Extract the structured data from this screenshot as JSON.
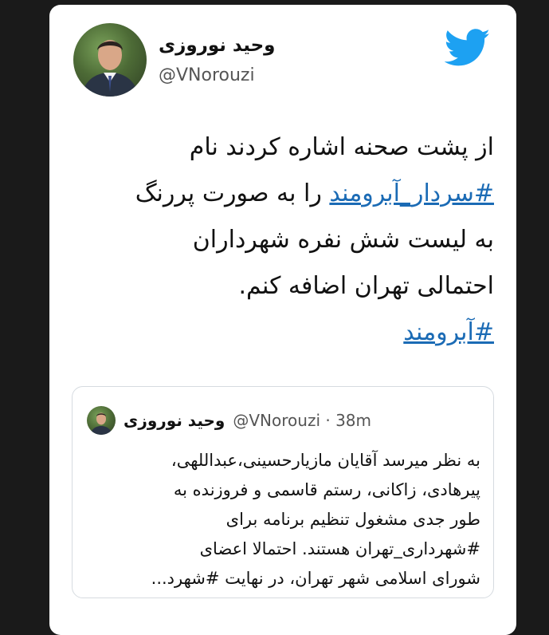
{
  "tweet": {
    "author_name": "وحید نوروزی",
    "author_handle": "@VNorouzi",
    "lines": [
      "از پشت صحنه اشاره کردند نام",
      "را به صورت پررنگ",
      "به لیست شش نفره شهرداران",
      "احتمالی تهران اضافه کنم."
    ],
    "hashtag_1": "#سردار_آبرومند",
    "hashtag_2": "#آبرومند"
  },
  "quoted": {
    "author_name": "وحید نوروزی",
    "handle_time": "@VNorouzi · 38m",
    "lines": [
      "به نظر میرسد آقایان مازیارحسینی،عبداللهی،",
      "پیرهادی، زاکانی، رستم قاسمی و فروزنده به",
      "طور جدی مشغول تنظیم برنامه برای",
      "#شهرداری_تهران هستند. احتمالا اعضای",
      "شورای اسلامی شهر تهران، در نهایت #شهرد..."
    ]
  },
  "icons": {
    "brand": "twitter-bird-icon"
  },
  "colors": {
    "brand_blue": "#1da1f2",
    "link_blue": "#1b6bb5"
  }
}
